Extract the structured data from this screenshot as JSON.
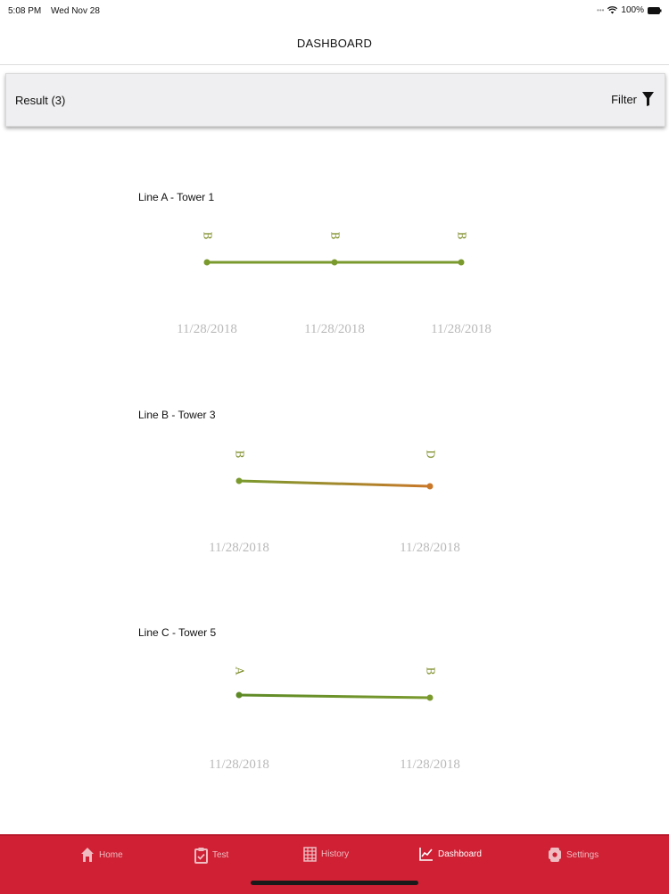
{
  "status_bar": {
    "time": "5:08 PM",
    "date": "Wed Nov 28",
    "battery": "100%"
  },
  "nav": {
    "title": "DASHBOARD"
  },
  "results": {
    "label": "Result (3)",
    "filter_label": "Filter"
  },
  "colors": {
    "tab_bar": "#cf2034",
    "line_green": "#7a9a2e",
    "line_orange": "#c9782a"
  },
  "charts": [
    {
      "title": "Line A - Tower 1",
      "chart_data": {
        "type": "line",
        "x": [
          "11/28/2018",
          "11/28/2018",
          "11/28/2018"
        ],
        "series": [
          {
            "values": [
              "B",
              "B",
              "B"
            ]
          }
        ]
      }
    },
    {
      "title": "Line B - Tower 3",
      "chart_data": {
        "type": "line",
        "x": [
          "11/28/2018",
          "11/28/2018"
        ],
        "series": [
          {
            "values": [
              "B",
              "D"
            ]
          }
        ]
      }
    },
    {
      "title": "Line C - Tower 5",
      "chart_data": {
        "type": "line",
        "x": [
          "11/28/2018",
          "11/28/2018"
        ],
        "series": [
          {
            "values": [
              "A",
              "B"
            ]
          }
        ]
      }
    }
  ],
  "tabs": [
    {
      "label": "Home",
      "icon": "home-icon"
    },
    {
      "label": "Test",
      "icon": "clipboard-icon"
    },
    {
      "label": "History",
      "icon": "grid-icon"
    },
    {
      "label": "Dashboard",
      "icon": "chart-icon",
      "active": true
    },
    {
      "label": "Settings",
      "icon": "gear-icon"
    }
  ]
}
